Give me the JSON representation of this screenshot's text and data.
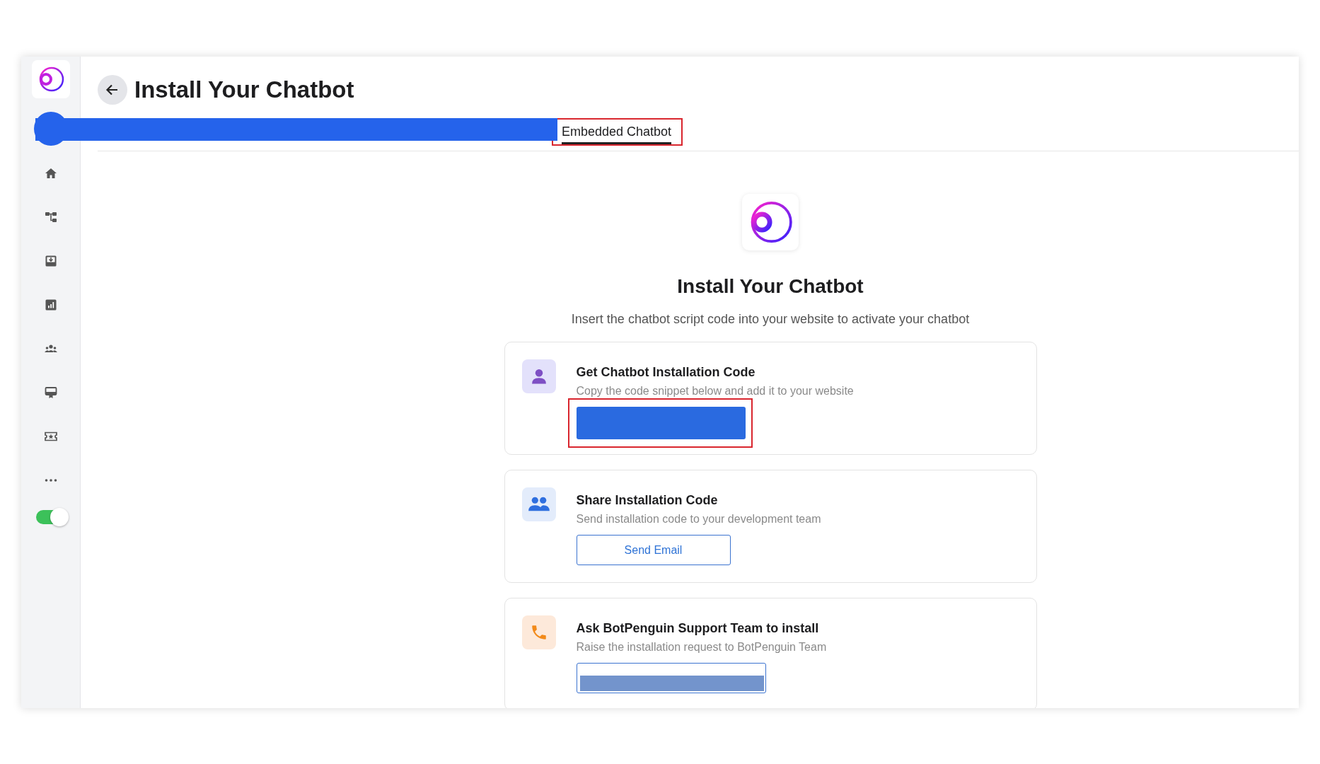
{
  "sidebar": {
    "items": [
      {
        "kind": "home"
      },
      {
        "kind": "flow"
      },
      {
        "kind": "inbox"
      },
      {
        "kind": "chart"
      },
      {
        "kind": "team"
      },
      {
        "kind": "certificate"
      },
      {
        "kind": "ticket"
      },
      {
        "kind": "more"
      }
    ],
    "toggle": {
      "on": true
    }
  },
  "header": {
    "title": "Install Your Chatbot"
  },
  "tabs": [
    {
      "label": "Embedded Chatbot",
      "selected": true
    }
  ],
  "hero": {
    "title": "Install Your Chatbot",
    "subtitle": "Insert the chatbot script code into your website to activate your chatbot"
  },
  "cards": [
    {
      "kind": "code",
      "title": "Get Chatbot Installation Code",
      "description": "Copy the code snippet below and add it to your website"
    },
    {
      "kind": "share",
      "title": "Share Installation Code",
      "description": "Send installation code to your development team",
      "button": "Send Email"
    },
    {
      "kind": "support",
      "title": "Ask BotPenguin Support Team to install",
      "description": "Raise the installation request to BotPenguin Team"
    }
  ]
}
